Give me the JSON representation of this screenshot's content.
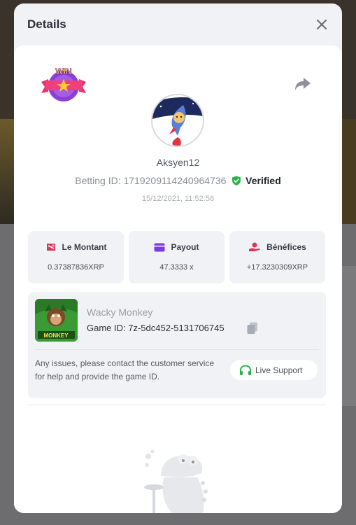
{
  "modal": {
    "title": "Details",
    "close_icon": "close-icon",
    "share_icon": "share-icon",
    "badge_text": "WIN"
  },
  "player": {
    "username": "Aksyen12",
    "betting_id_label": "Betting ID: 1719209114240964736",
    "verified_label": "Verified",
    "timestamp": "15/12/2021, 11:52:56"
  },
  "stats": [
    {
      "label": "Le Montant",
      "value": "0.37387836XRP",
      "icon": "bet-amount-icon"
    },
    {
      "label": "Payout",
      "value": "47.3333 x",
      "icon": "payout-card-icon"
    },
    {
      "label": "Bénéfices",
      "value": "+17.3230309XRP",
      "icon": "profit-hand-icon"
    }
  ],
  "game": {
    "name": "Wacky Monkey",
    "game_id_label": "Game ID: 7z-5dc452-5131706745",
    "thumb_text": "MONKEY",
    "issue_text": "Any issues, please contact the customer service for help and provide the game ID.",
    "support_label": "Live Support"
  },
  "colors": {
    "verified_green": "#2bb34a",
    "stat_icon_red": "#e0335a",
    "payout_purple": "#7a3be0",
    "support_green": "#2bb34a"
  }
}
